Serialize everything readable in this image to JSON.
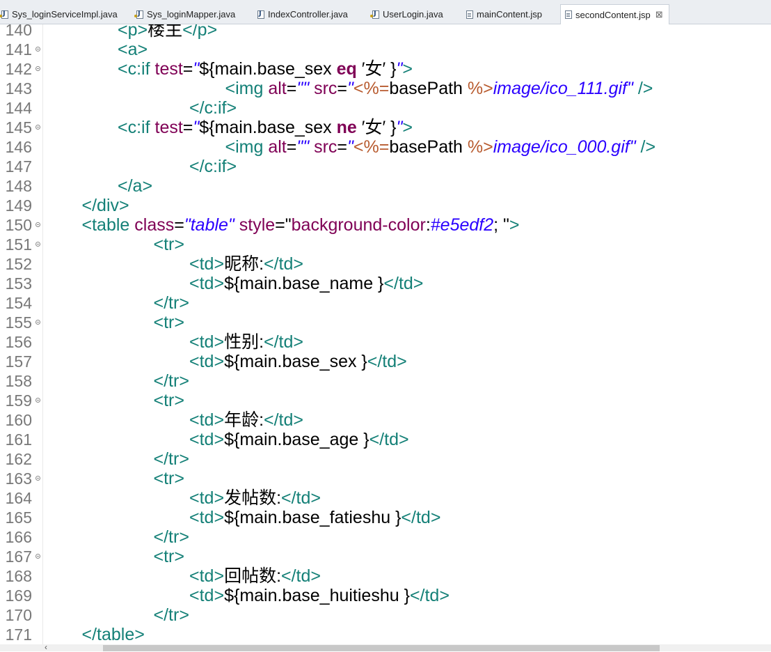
{
  "tabs": [
    {
      "label": "Sys_loginServiceImpl.java",
      "icon": "java-file-icon",
      "active": false
    },
    {
      "label": "Sys_loginMapper.java",
      "icon": "java-file-icon",
      "active": false
    },
    {
      "label": "IndexController.java",
      "icon": "java-file-icon",
      "active": false
    },
    {
      "label": "UserLogin.java",
      "icon": "java-file-icon",
      "active": false
    },
    {
      "label": "mainContent.jsp",
      "icon": "jsp-file-icon",
      "active": false
    },
    {
      "label": "secondContent.jsp",
      "icon": "jsp-file-icon",
      "active": true
    }
  ],
  "close_glyph": "⊠",
  "scroll_arrow": "‹",
  "colors": {
    "tag": "#148077",
    "attr": "#7f0055",
    "string": "#2a00ff",
    "jsp": "#b85b2f",
    "keyword": "#7f0055",
    "line_number": "#787878"
  },
  "editor": {
    "lines": [
      {
        "num": "140",
        "fold": false,
        "indent": 2,
        "tokens": [
          {
            "c": "t",
            "v": "<p>"
          },
          {
            "c": "x",
            "v": "楼主"
          },
          {
            "c": "t",
            "v": "</p>"
          }
        ]
      },
      {
        "num": "141",
        "fold": true,
        "indent": 2,
        "tokens": [
          {
            "c": "t",
            "v": "<a>"
          }
        ]
      },
      {
        "num": "142",
        "fold": true,
        "indent": 2,
        "tokens": [
          {
            "c": "t",
            "v": "<c:if "
          },
          {
            "c": "a",
            "v": "test"
          },
          {
            "c": "x",
            "v": "="
          },
          {
            "c": "s",
            "v": "\""
          },
          {
            "c": "x",
            "v": "${main.base_sex "
          },
          {
            "c": "k",
            "v": "eq"
          },
          {
            "c": "x",
            "v": " ′女′ }"
          },
          {
            "c": "s",
            "v": "\""
          },
          {
            "c": "t",
            "v": ">"
          }
        ]
      },
      {
        "num": "143",
        "fold": false,
        "indent": 5,
        "tokens": [
          {
            "c": "t",
            "v": "<img "
          },
          {
            "c": "a",
            "v": "alt"
          },
          {
            "c": "x",
            "v": "="
          },
          {
            "c": "s",
            "v": "\"\" "
          },
          {
            "c": "a",
            "v": "src"
          },
          {
            "c": "x",
            "v": "="
          },
          {
            "c": "s",
            "v": "\""
          },
          {
            "c": "j",
            "v": "<%="
          },
          {
            "c": "x",
            "v": "basePath "
          },
          {
            "c": "j",
            "v": "%>"
          },
          {
            "c": "s",
            "v": "image/ico_111.gif\" "
          },
          {
            "c": "t",
            "v": "/>"
          }
        ]
      },
      {
        "num": "144",
        "fold": false,
        "indent": 4,
        "tokens": [
          {
            "c": "t",
            "v": "</c:if>"
          }
        ]
      },
      {
        "num": "145",
        "fold": true,
        "indent": 2,
        "tokens": [
          {
            "c": "t",
            "v": "<c:if "
          },
          {
            "c": "a",
            "v": "test"
          },
          {
            "c": "x",
            "v": "="
          },
          {
            "c": "s",
            "v": "\""
          },
          {
            "c": "x",
            "v": "${main.base_sex "
          },
          {
            "c": "k",
            "v": "ne"
          },
          {
            "c": "x",
            "v": " ′女′ }"
          },
          {
            "c": "s",
            "v": "\""
          },
          {
            "c": "t",
            "v": ">"
          }
        ]
      },
      {
        "num": "146",
        "fold": false,
        "indent": 5,
        "tokens": [
          {
            "c": "t",
            "v": "<img "
          },
          {
            "c": "a",
            "v": "alt"
          },
          {
            "c": "x",
            "v": "="
          },
          {
            "c": "s",
            "v": "\"\" "
          },
          {
            "c": "a",
            "v": "src"
          },
          {
            "c": "x",
            "v": "="
          },
          {
            "c": "s",
            "v": "\""
          },
          {
            "c": "j",
            "v": "<%="
          },
          {
            "c": "x",
            "v": "basePath "
          },
          {
            "c": "j",
            "v": "%>"
          },
          {
            "c": "s",
            "v": "image/ico_000.gif\" "
          },
          {
            "c": "t",
            "v": "/>"
          }
        ]
      },
      {
        "num": "147",
        "fold": false,
        "indent": 4,
        "tokens": [
          {
            "c": "t",
            "v": "</c:if>"
          }
        ]
      },
      {
        "num": "148",
        "fold": false,
        "indent": 2,
        "tokens": [
          {
            "c": "t",
            "v": "</a>"
          }
        ]
      },
      {
        "num": "149",
        "fold": false,
        "indent": 1,
        "tokens": [
          {
            "c": "t",
            "v": "</div>"
          }
        ]
      },
      {
        "num": "150",
        "fold": true,
        "indent": 1,
        "tokens": [
          {
            "c": "t",
            "v": "<table "
          },
          {
            "c": "a",
            "v": "class"
          },
          {
            "c": "x",
            "v": "="
          },
          {
            "c": "s",
            "v": "\"table\" "
          },
          {
            "c": "a",
            "v": "style"
          },
          {
            "c": "x",
            "v": "=\""
          },
          {
            "c": "a",
            "v": "background-color"
          },
          {
            "c": "x",
            "v": ":"
          },
          {
            "c": "s",
            "v": "#e5edf2"
          },
          {
            "c": "x",
            "v": "; \""
          },
          {
            "c": "t",
            "v": ">"
          }
        ]
      },
      {
        "num": "151",
        "fold": true,
        "indent": 3,
        "tokens": [
          {
            "c": "t",
            "v": "<tr>"
          }
        ]
      },
      {
        "num": "152",
        "fold": false,
        "indent": 4,
        "tokens": [
          {
            "c": "t",
            "v": "<td>"
          },
          {
            "c": "x",
            "v": "昵称:"
          },
          {
            "c": "t",
            "v": "</td>"
          }
        ]
      },
      {
        "num": "153",
        "fold": false,
        "indent": 4,
        "tokens": [
          {
            "c": "t",
            "v": "<td>"
          },
          {
            "c": "x",
            "v": "${main.base_name }"
          },
          {
            "c": "t",
            "v": "</td>"
          }
        ]
      },
      {
        "num": "154",
        "fold": false,
        "indent": 3,
        "tokens": [
          {
            "c": "t",
            "v": "</tr>"
          }
        ]
      },
      {
        "num": "155",
        "fold": true,
        "indent": 3,
        "tokens": [
          {
            "c": "t",
            "v": "<tr>"
          }
        ]
      },
      {
        "num": "156",
        "fold": false,
        "indent": 4,
        "tokens": [
          {
            "c": "t",
            "v": "<td>"
          },
          {
            "c": "x",
            "v": "性别:"
          },
          {
            "c": "t",
            "v": "</td>"
          }
        ]
      },
      {
        "num": "157",
        "fold": false,
        "indent": 4,
        "tokens": [
          {
            "c": "t",
            "v": "<td>"
          },
          {
            "c": "x",
            "v": "${main.base_sex }"
          },
          {
            "c": "t",
            "v": "</td>"
          }
        ]
      },
      {
        "num": "158",
        "fold": false,
        "indent": 3,
        "tokens": [
          {
            "c": "t",
            "v": "</tr>"
          }
        ]
      },
      {
        "num": "159",
        "fold": true,
        "indent": 3,
        "tokens": [
          {
            "c": "t",
            "v": "<tr>"
          }
        ]
      },
      {
        "num": "160",
        "fold": false,
        "indent": 4,
        "tokens": [
          {
            "c": "t",
            "v": "<td>"
          },
          {
            "c": "x",
            "v": "年龄:"
          },
          {
            "c": "t",
            "v": "</td>"
          }
        ]
      },
      {
        "num": "161",
        "fold": false,
        "indent": 4,
        "tokens": [
          {
            "c": "t",
            "v": "<td>"
          },
          {
            "c": "x",
            "v": "${main.base_age }"
          },
          {
            "c": "t",
            "v": "</td>"
          }
        ]
      },
      {
        "num": "162",
        "fold": false,
        "indent": 3,
        "tokens": [
          {
            "c": "t",
            "v": "</tr>"
          }
        ]
      },
      {
        "num": "163",
        "fold": true,
        "indent": 3,
        "tokens": [
          {
            "c": "t",
            "v": "<tr>"
          }
        ]
      },
      {
        "num": "164",
        "fold": false,
        "indent": 4,
        "tokens": [
          {
            "c": "t",
            "v": "<td>"
          },
          {
            "c": "x",
            "v": "发帖数:"
          },
          {
            "c": "t",
            "v": "</td>"
          }
        ]
      },
      {
        "num": "165",
        "fold": false,
        "indent": 4,
        "tokens": [
          {
            "c": "t",
            "v": "<td>"
          },
          {
            "c": "x",
            "v": "${main.base_fatieshu }"
          },
          {
            "c": "t",
            "v": "</td>"
          }
        ]
      },
      {
        "num": "166",
        "fold": false,
        "indent": 3,
        "tokens": [
          {
            "c": "t",
            "v": "</tr>"
          }
        ]
      },
      {
        "num": "167",
        "fold": true,
        "indent": 3,
        "tokens": [
          {
            "c": "t",
            "v": "<tr>"
          }
        ]
      },
      {
        "num": "168",
        "fold": false,
        "indent": 4,
        "tokens": [
          {
            "c": "t",
            "v": "<td>"
          },
          {
            "c": "x",
            "v": "回帖数:"
          },
          {
            "c": "t",
            "v": "</td>"
          }
        ]
      },
      {
        "num": "169",
        "fold": false,
        "indent": 4,
        "tokens": [
          {
            "c": "t",
            "v": "<td>"
          },
          {
            "c": "x",
            "v": "${main.base_huitieshu }"
          },
          {
            "c": "t",
            "v": "</td>"
          }
        ]
      },
      {
        "num": "170",
        "fold": false,
        "indent": 3,
        "tokens": [
          {
            "c": "t",
            "v": "</tr>"
          }
        ]
      },
      {
        "num": "171",
        "fold": false,
        "indent": 1,
        "tokens": [
          {
            "c": "t",
            "v": "</table>"
          }
        ]
      }
    ]
  }
}
